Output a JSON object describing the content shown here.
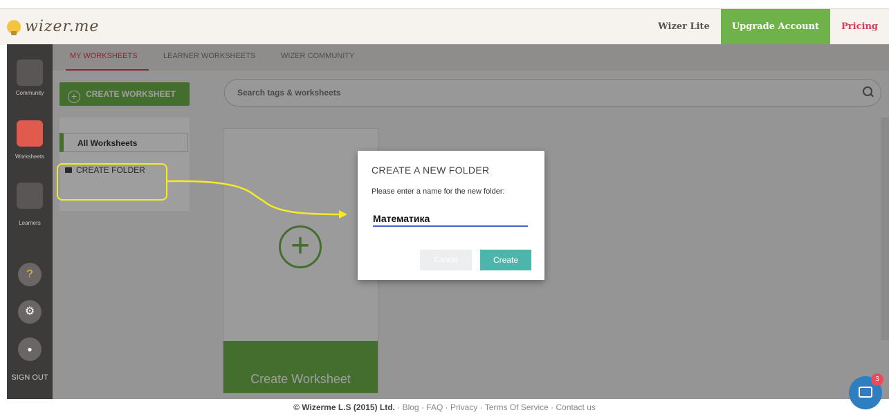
{
  "header": {
    "logo": "wizer.me",
    "links": [
      "Wizer Lite",
      "Upgrade Account",
      "Pricing"
    ]
  },
  "sidebar": {
    "items": [
      {
        "label": "Community",
        "icon": "community-icon"
      },
      {
        "label": "Worksheets",
        "icon": "worksheets-icon"
      },
      {
        "label": "Learners",
        "icon": "learners-icon"
      }
    ],
    "buttons": [
      {
        "icon": "help-icon",
        "glyph": "?"
      },
      {
        "icon": "gear-icon",
        "glyph": "⚙"
      },
      {
        "icon": "user-icon",
        "glyph": "●"
      }
    ],
    "sign_out": "SIGN OUT"
  },
  "tabs": [
    "MY WORKSHEETS",
    "LEARNER WORKSHEETS",
    "WIZER COMMUNITY"
  ],
  "create_worksheet_button": "CREATE WORKSHEET",
  "search": {
    "placeholder": "Search tags & worksheets"
  },
  "folders": {
    "all": "All Worksheets",
    "create": "CREATE FOLDER"
  },
  "card": {
    "plus": "+",
    "label": "Create Worksheet"
  },
  "dialog": {
    "title": "CREATE A NEW FOLDER",
    "prompt": "Please enter a name for the new folder:",
    "input_value": "Математика",
    "cancel": "Cancel",
    "create": "Create"
  },
  "footer": {
    "copyright": "© Wizerme L.S (2015) Ltd.",
    "links": [
      "Blog",
      "FAQ",
      "Privacy",
      "Terms Of Service",
      "Contact us"
    ]
  },
  "chat": {
    "badge": "3"
  },
  "colors": {
    "accent_green": "#6fb24a",
    "accent_red": "#d1405a",
    "dialog_create": "#4db6ac"
  }
}
